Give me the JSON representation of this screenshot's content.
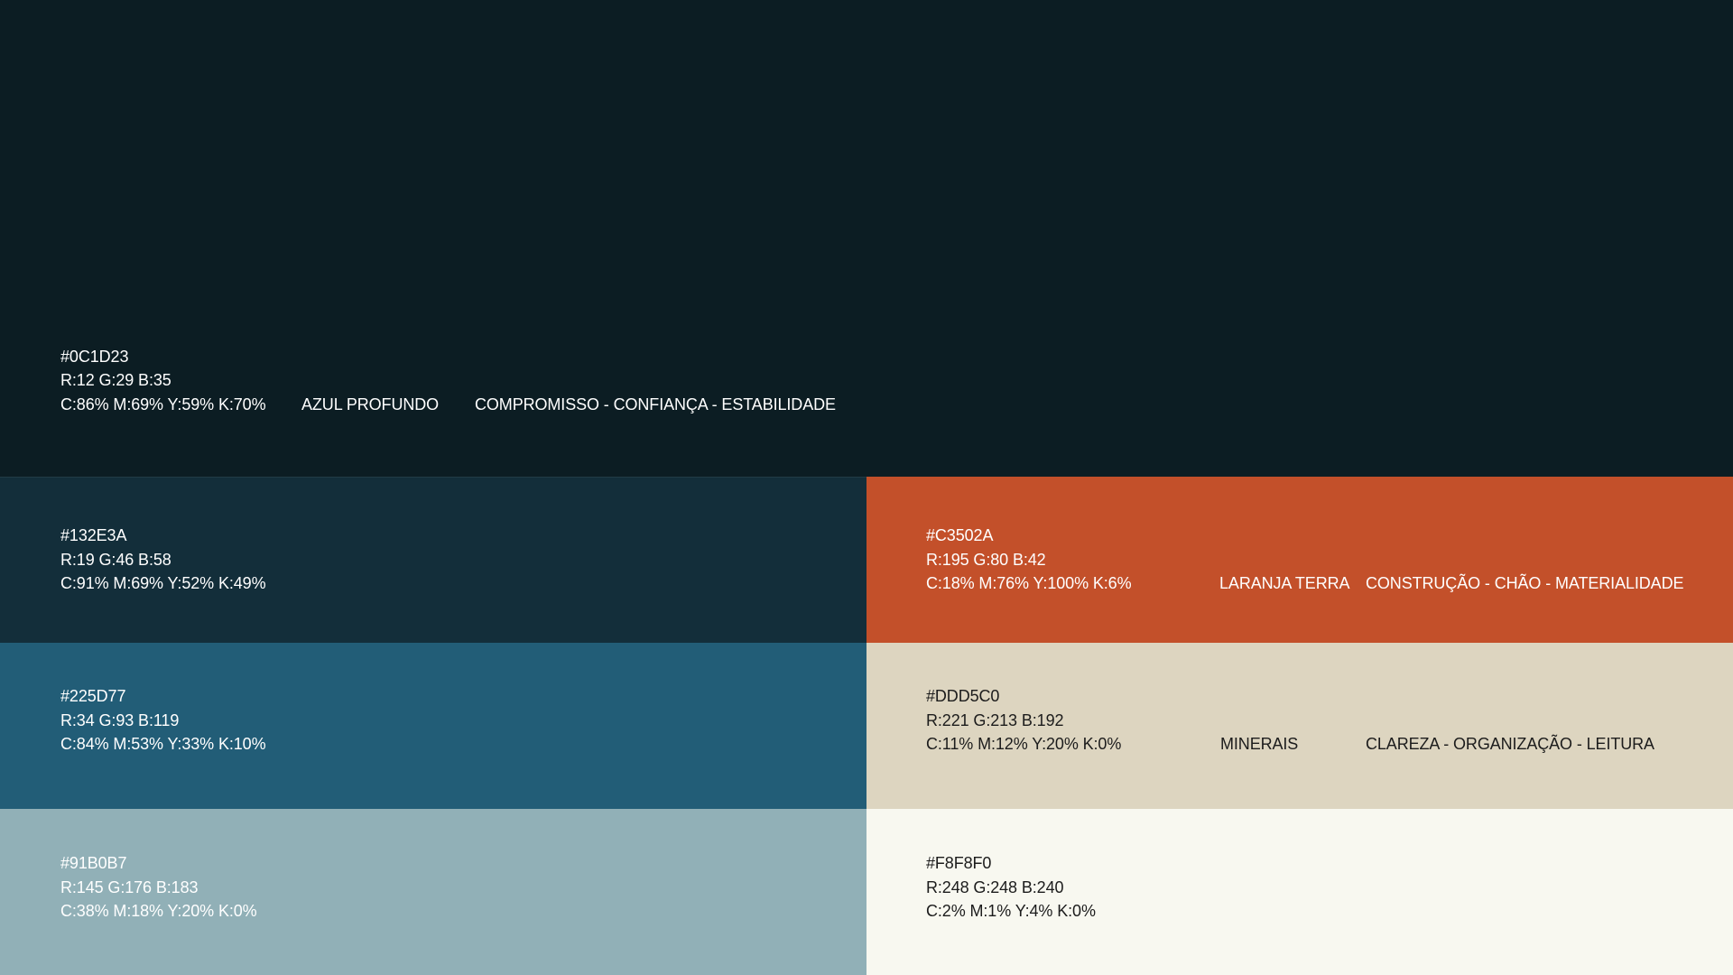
{
  "swatches": {
    "azul_profundo": {
      "color": "#0C1D23",
      "hex": "#0C1D23",
      "rgb": "R:12  G:29  B:35",
      "cmyk": "C:86%  M:69%  Y:59%  K:70%",
      "name": "AZUL PROFUNDO",
      "tags": "COMPROMISSO - CONFIANÇA - ESTABILIDADE"
    },
    "s132e3a": {
      "color": "#132E3A",
      "hex": "#132E3A",
      "rgb": "R:19  G:46  B:58",
      "cmyk": "C:91%  M:69%  Y:52%  K:49%"
    },
    "laranja_terra": {
      "color": "#C3502A",
      "hex": "#C3502A",
      "rgb": "R:195  G:80  B:42",
      "cmyk": "C:18%  M:76%  Y:100%  K:6%",
      "name": "LARANJA TERRA",
      "tags": "CONSTRUÇÃO - CHÃO -  MATERIALIDADE"
    },
    "s225d77": {
      "color": "#225D77",
      "hex": "#225D77",
      "rgb": "R:34  G:93  B:119",
      "cmyk": "C:84%  M:53%  Y:33%  K:10%"
    },
    "minerais": {
      "color": "#DDD5C0",
      "hex": "#DDD5C0",
      "rgb": "R:221  G:213  B:192",
      "cmyk": "C:11%  M:12%  Y:20%  K:0%",
      "name": "MINERAIS",
      "tags": "CLAREZA - ORGANIZAÇÃO -  LEITURA"
    },
    "s91b0b7": {
      "color": "#91B0B7",
      "hex": "#91B0B7",
      "rgb": "R:145  G:176  B:183",
      "cmyk": "C:38%  M:18%  Y:20%  K:0%"
    },
    "sf8f8f0": {
      "color": "#F8F8F0",
      "hex": "#F8F8F0",
      "rgb": "R:248  G:248  B:240",
      "cmyk": "C:2%  M:1%  Y:4%  K:0%"
    }
  }
}
